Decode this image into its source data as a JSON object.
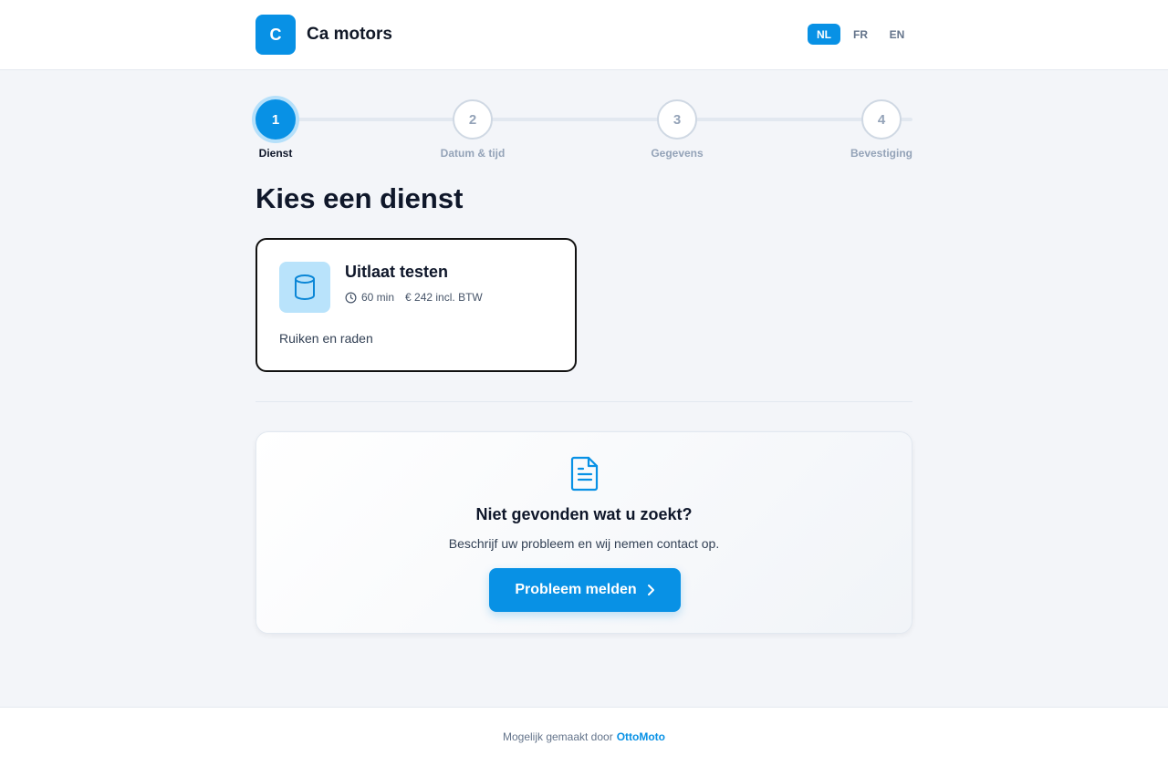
{
  "header": {
    "logo_letter": "C",
    "brand_name": "Ca motors",
    "languages": [
      {
        "code": "NL",
        "active": true
      },
      {
        "code": "FR",
        "active": false
      },
      {
        "code": "EN",
        "active": false
      }
    ]
  },
  "stepper": {
    "steps": [
      {
        "number": "1",
        "label": "Dienst",
        "active": true
      },
      {
        "number": "2",
        "label": "Datum & tijd",
        "active": false
      },
      {
        "number": "3",
        "label": "Gegevens",
        "active": false
      },
      {
        "number": "4",
        "label": "Bevestiging",
        "active": false
      }
    ]
  },
  "main": {
    "title": "Kies een dienst",
    "service": {
      "icon": "cylinder-icon",
      "name": "Uitlaat testen",
      "duration": "60 min",
      "price": "€ 242 incl. BTW",
      "description": "Ruiken en raden"
    }
  },
  "help": {
    "icon": "document-icon",
    "title": "Niet gevonden wat u zoekt?",
    "subtitle": "Beschrijf uw probleem en wij nemen contact op.",
    "button_label": "Probleem melden"
  },
  "footer": {
    "text": "Mogelijk gemaakt door",
    "link_label": "OttoMoto"
  },
  "colors": {
    "accent": "#0891e5",
    "icon_bg": "#b9e3fb",
    "page_bg": "#f3f5f9",
    "text_primary": "#0f172a"
  }
}
